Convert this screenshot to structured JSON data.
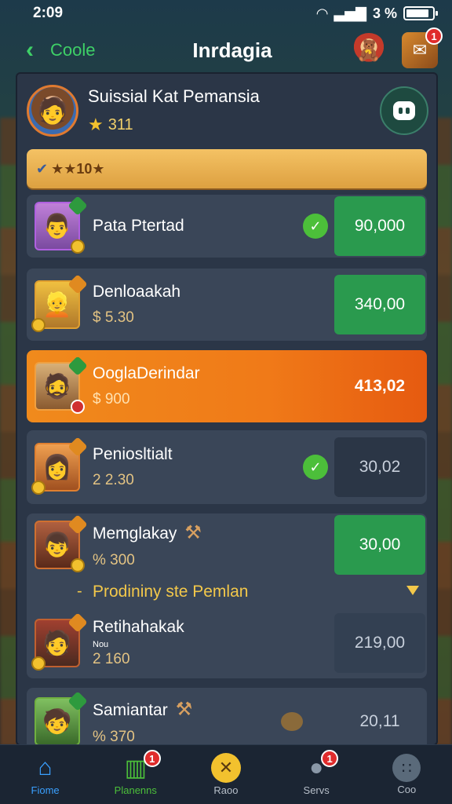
{
  "status_bar": {
    "time": "2:09",
    "battery_text": "3 %"
  },
  "header": {
    "back_label": "Coole",
    "title": "Inrdagia",
    "chest_badge": "1"
  },
  "profile": {
    "name": "Suissial Kat Pemansia",
    "stars": "311"
  },
  "gold_bar": {
    "label": "★★10★"
  },
  "rows": [
    {
      "name": "Pata Ptertad",
      "sub": "",
      "value": "90,000"
    },
    {
      "name": "Denloaakah",
      "sub": "$ 5.30",
      "value": "340,00"
    },
    {
      "name": "OoglaDerindar",
      "sub": "$ 900",
      "value": "413,02"
    },
    {
      "name": "Peniosltialt",
      "sub": "2 2.30",
      "value": "30,02"
    },
    {
      "name": "Memglakay",
      "sub": "% 300",
      "value": "30,00"
    },
    {
      "name": "Retihahakak",
      "sub_small": "Nou",
      "sub": "2 160",
      "value": "219,00"
    },
    {
      "name": "Samiantar",
      "sub": "% 370",
      "value": "20,11"
    }
  ],
  "subheading": "Prodininy ste Pemlan",
  "nav": {
    "items": [
      {
        "label": "Fiome"
      },
      {
        "label": "Planenns",
        "badge": "1"
      },
      {
        "label": "Raoo"
      },
      {
        "label": "Servs",
        "badge": "1"
      },
      {
        "label": "Coo"
      }
    ]
  },
  "colors": {
    "accent_green": "#3ed067",
    "highlight_orange": "#f08a1c",
    "gold": "#f2c12e",
    "nav_active": "#3aa0ff"
  },
  "icons": [
    "back-chevron-icon",
    "wifi-icon",
    "signal-icon",
    "battery-icon",
    "chest-icon",
    "star-icon",
    "chat-icon",
    "check-icon",
    "tool-icon",
    "home-icon",
    "planes-icon",
    "race-icon",
    "servs-icon",
    "code-icon"
  ]
}
